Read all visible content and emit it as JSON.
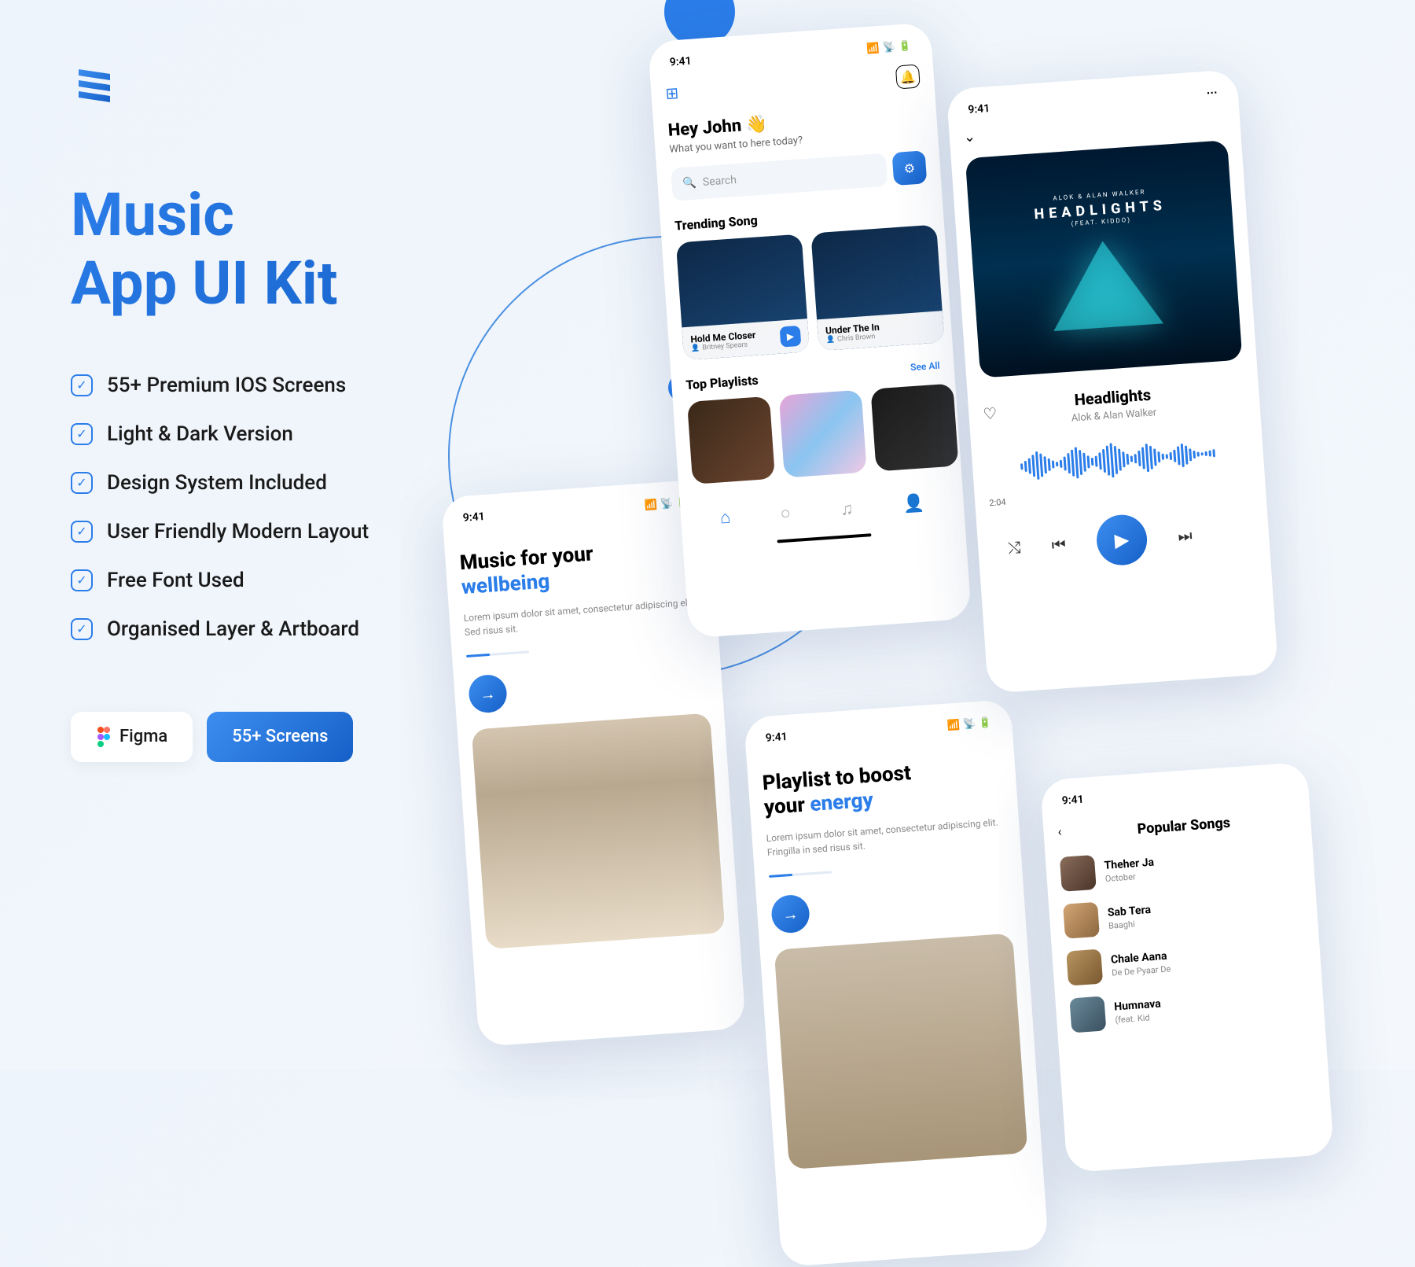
{
  "title_line1": "Music",
  "title_line2": "App UI Kit",
  "features": [
    "55+ Premium IOS Screens",
    "Light & Dark Version",
    "Design System Included",
    "User Friendly Modern Layout",
    "Free Font Used",
    "Organised Layer & Artboard"
  ],
  "badge_figma": "Figma",
  "badge_screens": "55+ Screens",
  "status_time": "9:41",
  "phone1": {
    "title_pre": "Music for your",
    "title_accent": "wellbeing",
    "desc": "Lorem ipsum dolor sit amet, consectetur adipiscing elit. Sed risus sit."
  },
  "phone2": {
    "greeting": "Hey John 👋",
    "subtitle": "What you want to here today?",
    "search_placeholder": "Search",
    "trending_label": "Trending Song",
    "card1_title": "Hold Me Closer",
    "card1_artist": "Britney Spears",
    "card2_title": "Under The In",
    "card2_artist": "Chris Brown",
    "playlists_label": "Top Playlists",
    "see_all": "See All"
  },
  "phone3": {
    "title_pre": "Playlist to boost",
    "title_pre2": "your ",
    "title_accent": "energy",
    "desc": "Lorem ipsum dolor sit amet, consectetur adipiscing elit. Fringilla in sed risus sit."
  },
  "phone4": {
    "album_pre": "ALOK & ALAN WALKER",
    "album_title": "HEADLIGHTS",
    "album_feat": "(FEAT. KIDDO)",
    "song_title": "Headlights",
    "song_artist": "Alok & Alan Walker",
    "time_elapsed": "2:04"
  },
  "phone5": {
    "title": "Popular Songs",
    "songs": [
      {
        "title": "Theher Ja",
        "album": "October"
      },
      {
        "title": "Sab Tera",
        "album": "Baaghi"
      },
      {
        "title": "Chale Aana",
        "album": "De De Pyaar De"
      },
      {
        "title": "Humnava",
        "album": "(feat. Kid"
      }
    ]
  }
}
